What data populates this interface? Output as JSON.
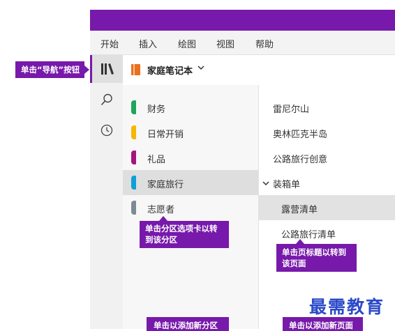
{
  "menu": {
    "items": [
      "开始",
      "插入",
      "绘图",
      "视图",
      "帮助"
    ]
  },
  "nav": {
    "icons": [
      "library-icon",
      "search-icon",
      "recent-icon"
    ]
  },
  "notebook": {
    "title": "家庭笔记本"
  },
  "sections": [
    {
      "label": "财务",
      "color": "#1fa55a"
    },
    {
      "label": "日常开销",
      "color": "#f5b800"
    },
    {
      "label": "礼品",
      "color": "#a4157e"
    },
    {
      "label": "家庭旅行",
      "color": "#0ea0d8",
      "selected": true
    },
    {
      "label": "志愿者",
      "color": "#7d8a95"
    }
  ],
  "pages": [
    {
      "label": "雷尼尔山"
    },
    {
      "label": "奥林匹克半岛"
    },
    {
      "label": "公路旅行创意"
    },
    {
      "label": "装箱单",
      "expanded": true
    },
    {
      "label": "露营清单",
      "subpage": true,
      "selected": true
    },
    {
      "label": "公路旅行清单",
      "subpage": true
    }
  ],
  "callouts": {
    "nav_button": "单击“导航”按钮",
    "section_tab_line1": "单击分区选项卡以转",
    "section_tab_line2": "到该分区",
    "page_title_line1": "单击页标题以转到",
    "page_title_line2": "该页面",
    "add_section": "单击以添加新分区",
    "add_page": "单击以添加新页面"
  },
  "watermark": "最需教育",
  "colors": {
    "accent": "#7719aa",
    "watermark": "#2b49c8"
  }
}
